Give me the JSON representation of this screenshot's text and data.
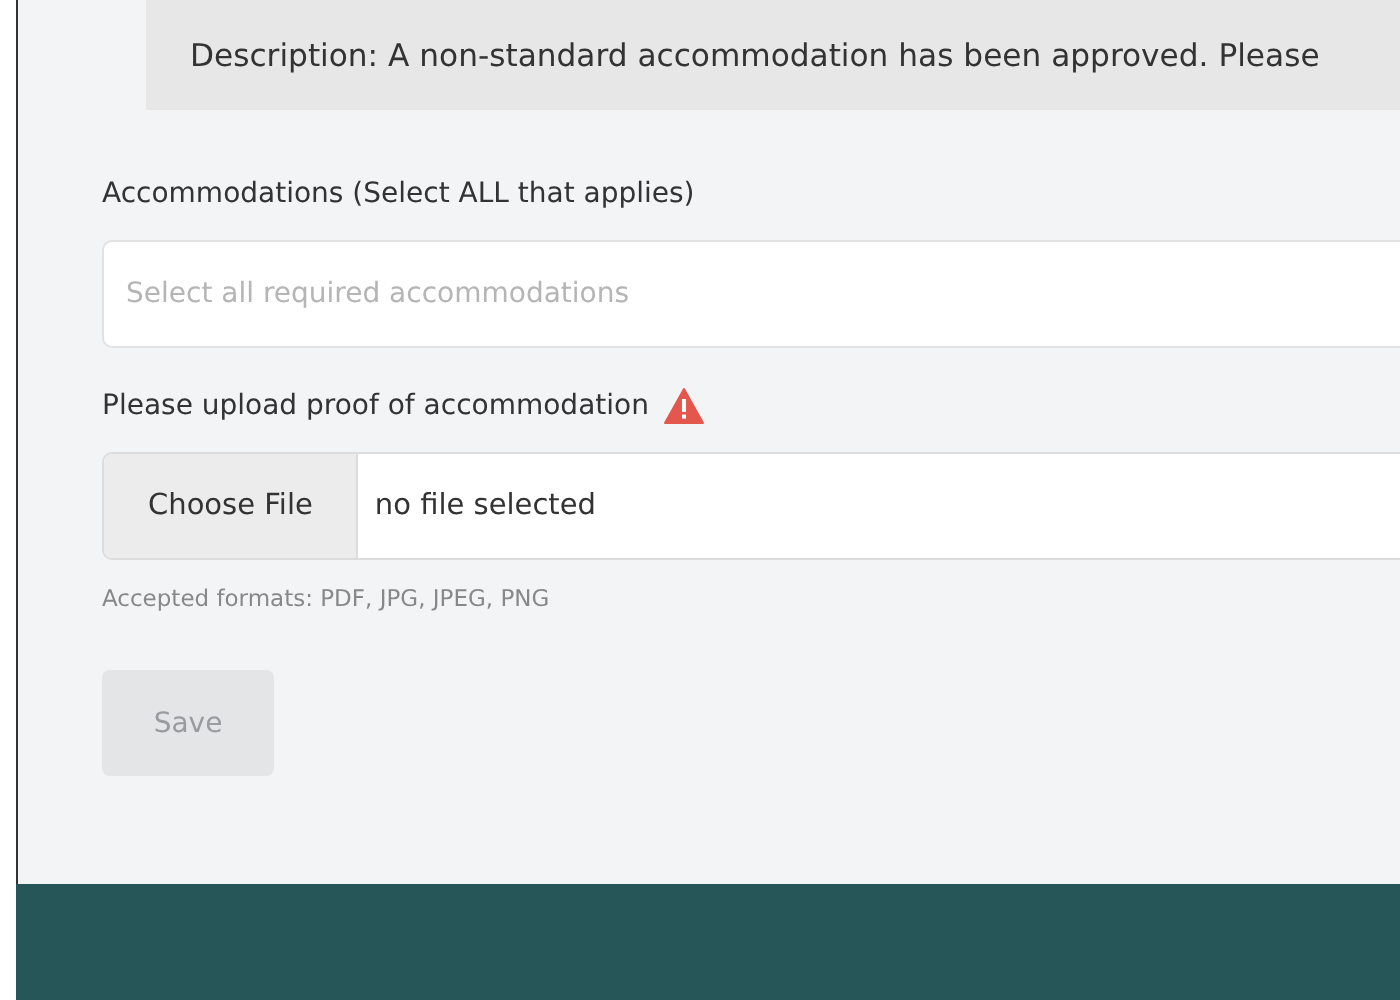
{
  "description": "Description: A non-standard accommodation has been approved. Please",
  "accommodations": {
    "label": "Accommodations (Select ALL that applies)",
    "placeholder": "Select all required accommodations"
  },
  "upload": {
    "label": "Please upload proof of accommodation",
    "warning": true,
    "button": "Choose File",
    "status": "no file selected",
    "hint": "Accepted formats: PDF, JPG, JPEG, PNG"
  },
  "save": {
    "label": "Save",
    "disabled": true
  }
}
